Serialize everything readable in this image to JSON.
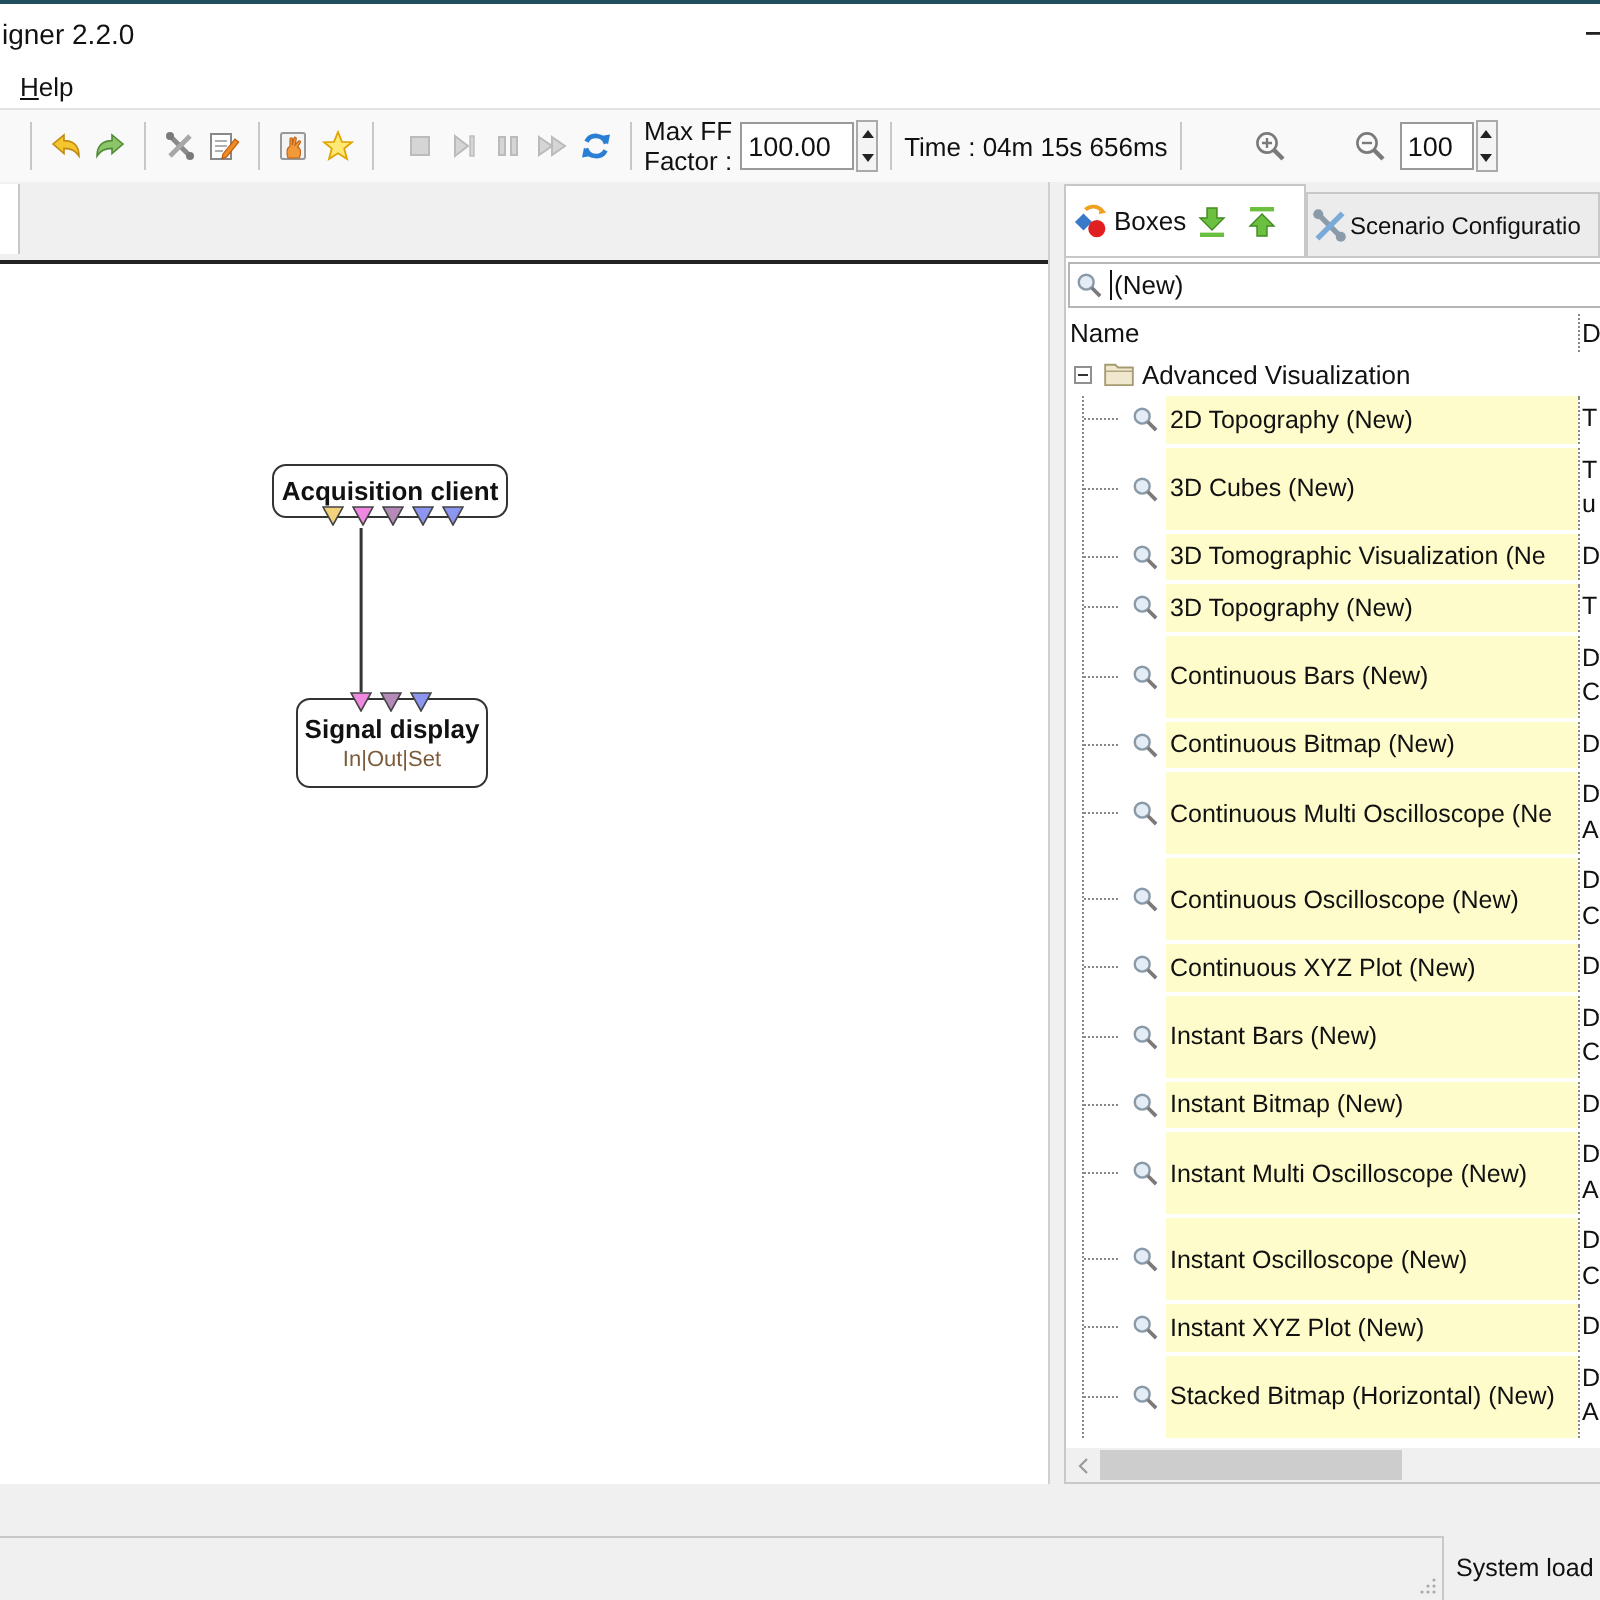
{
  "window": {
    "title": "igner 2.2.0"
  },
  "menu": [
    {
      "label": "Help"
    }
  ],
  "toolbar": {
    "buttons": [
      {
        "disabled": false
      },
      {
        "disabled": false
      },
      {
        "disabled": false
      },
      {
        "disabled": false
      },
      {
        "disabled": false
      },
      {
        "disabled": false
      },
      {
        "disabled": true
      },
      {
        "disabled": true
      },
      {
        "disabled": true
      },
      {
        "disabled": true
      },
      {
        "disabled": false
      }
    ],
    "max_ff": {
      "label": "Max FF\nFactor :",
      "value": "100.00"
    },
    "time": "Time : 04m 15s 656ms",
    "zoom": {
      "value": "100"
    }
  },
  "canvas": {
    "tabs": [
      {
        "selected": true
      }
    ],
    "nodes": [
      {
        "title": "Acquisition client",
        "outputs": [
          {
            "color": "#f2d27a"
          },
          {
            "color": "#ee88e0"
          },
          {
            "color": "#b58ab8"
          },
          {
            "color": "#8c95f0"
          },
          {
            "color": "#8c95f0"
          }
        ]
      },
      {
        "title": "Signal display",
        "subtitle": "In|Out|Set",
        "inputs": [
          {
            "color": "#ee88e0"
          },
          {
            "color": "#b58ab8"
          },
          {
            "color": "#8c95f0"
          }
        ]
      }
    ]
  },
  "right_panel": {
    "tabs": [
      {
        "label": "Boxes",
        "selected": true
      },
      {
        "label": "Scenario Configuratio",
        "selected": false
      }
    ],
    "search": {
      "value": "(New)"
    },
    "columns": [
      "Name",
      "D"
    ],
    "tree": [
      {
        "label": "Advanced Visualization",
        "expanded": true,
        "children": [
          {
            "label": "2D Topography (New)",
            "description": "T",
            "selected": false
          },
          {
            "label": "3D Cubes (New)",
            "description": "T\nu",
            "selected": false
          },
          {
            "label": "3D Tomographic Visualization (Ne",
            "description": "D",
            "selected": false
          },
          {
            "label": "3D Topography (New)",
            "description": "T",
            "selected": false
          },
          {
            "label": "Continuous Bars (New)",
            "description": "D\nC",
            "selected": false
          },
          {
            "label": "Continuous Bitmap (New)",
            "description": "D",
            "selected": false
          },
          {
            "label": "Continuous Multi Oscilloscope (Ne",
            "description": "D\nA",
            "selected": false
          },
          {
            "label": "Continuous Oscilloscope (New)",
            "description": "D\nC",
            "selected": false
          },
          {
            "label": "Continuous XYZ Plot (New)",
            "description": "D",
            "selected": false
          },
          {
            "label": "Instant Bars (New)",
            "description": "D\nC",
            "selected": false
          },
          {
            "label": "Instant Bitmap (New)",
            "description": "D",
            "selected": false
          },
          {
            "label": "Instant Multi Oscilloscope (New)",
            "description": "D\nA",
            "selected": false
          },
          {
            "label": "Instant Oscilloscope (New)",
            "description": "D\nC",
            "selected": false
          },
          {
            "label": "Instant XYZ Plot (New)",
            "description": "D",
            "selected": false
          },
          {
            "label": "Stacked Bitmap (Horizontal) (New)",
            "description": "D\nA",
            "selected": false
          }
        ]
      }
    ]
  },
  "status_bar": {
    "text": "System load"
  }
}
